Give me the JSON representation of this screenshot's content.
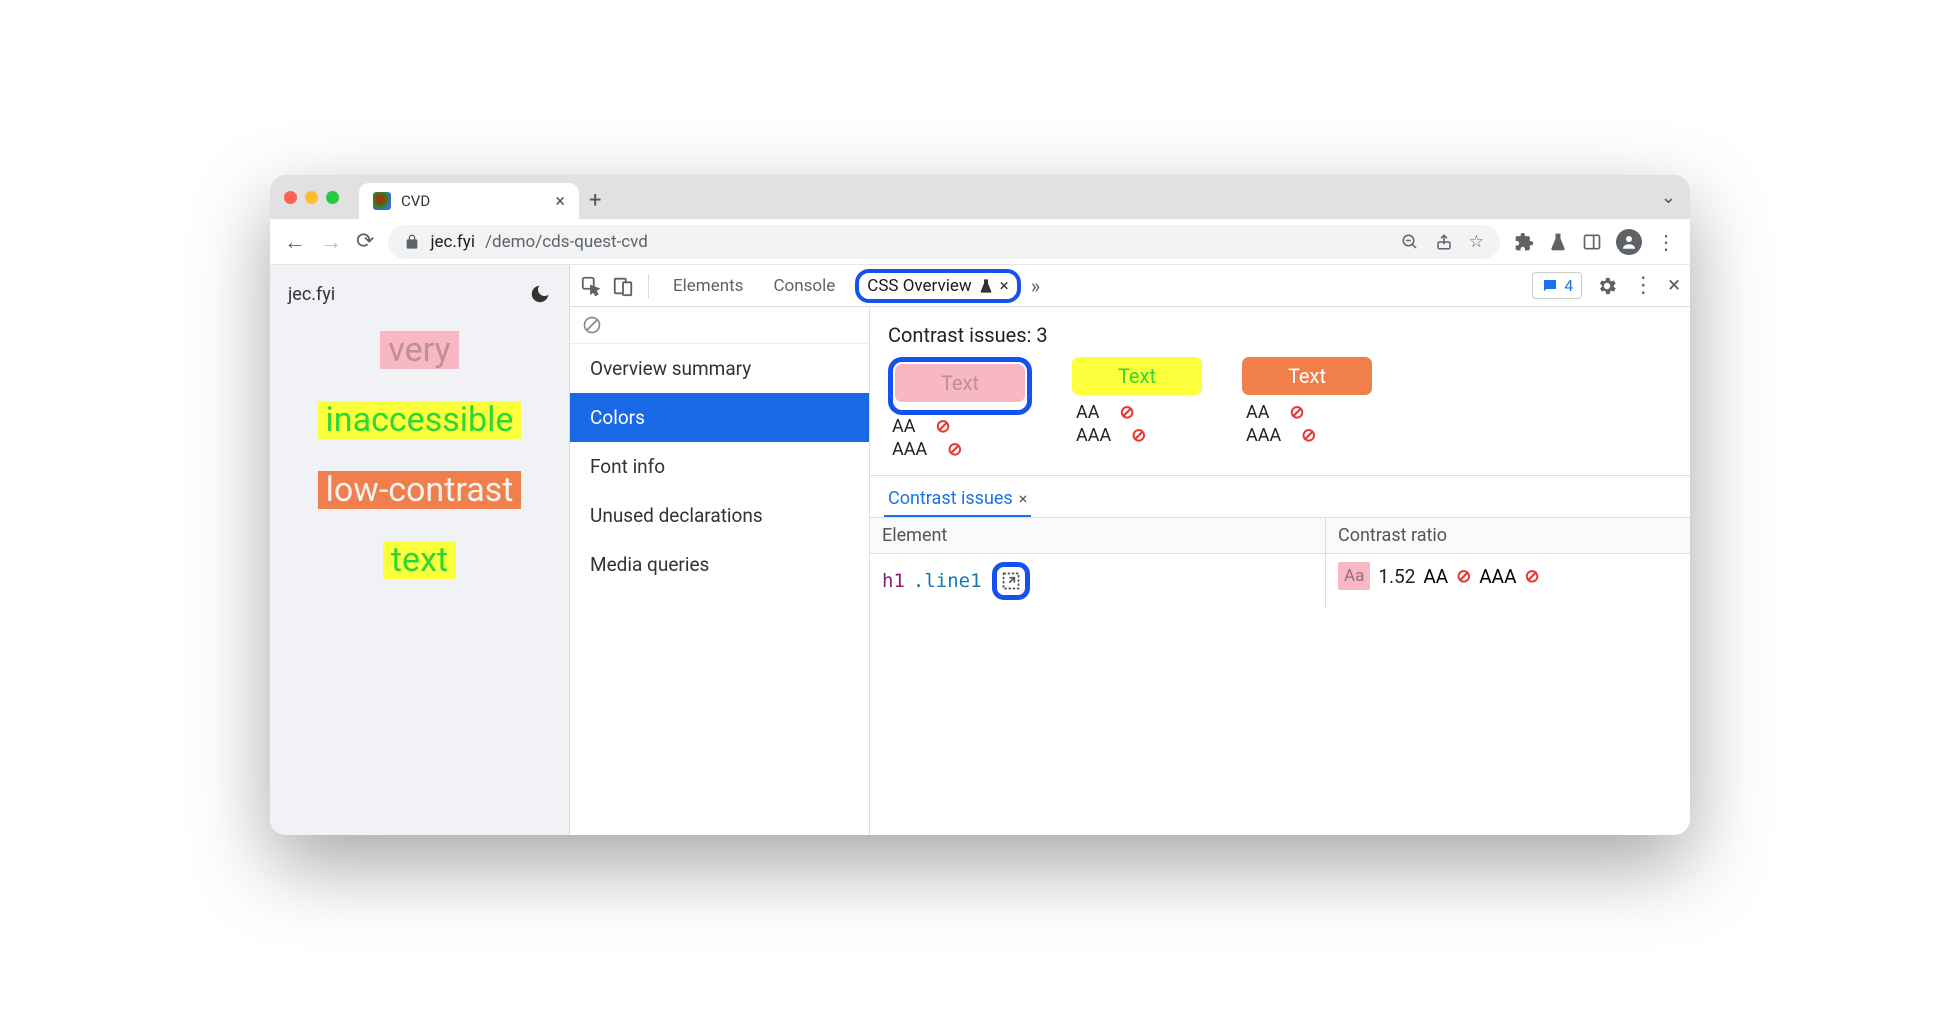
{
  "browser": {
    "tab_title": "CVD",
    "url_domain": "jec.fyi",
    "url_path": "/demo/cds-quest-cvd"
  },
  "page": {
    "title": "jec.fyi",
    "words": {
      "very": "very",
      "inaccessible": "inaccessible",
      "low_contrast": "low-contrast",
      "text": "text"
    }
  },
  "devtools": {
    "tabs": {
      "elements": "Elements",
      "console": "Console",
      "css_overview": "CSS Overview"
    },
    "messages_count": "4",
    "sidebar": {
      "overview": "Overview summary",
      "colors": "Colors",
      "font_info": "Font info",
      "unused": "Unused declarations",
      "media": "Media queries"
    },
    "contrast": {
      "heading": "Contrast issues: 3",
      "swatch_label": "Text",
      "aa": "AA",
      "aaa": "AAA",
      "sub_tab": "Contrast issues",
      "columns": {
        "element": "Element",
        "contrast_ratio": "Contrast ratio"
      },
      "row": {
        "tag": "h1",
        "class": ".line1",
        "badge": "Aa",
        "ratio": "1.52",
        "aa": "AA",
        "aaa": "AAA"
      }
    }
  }
}
